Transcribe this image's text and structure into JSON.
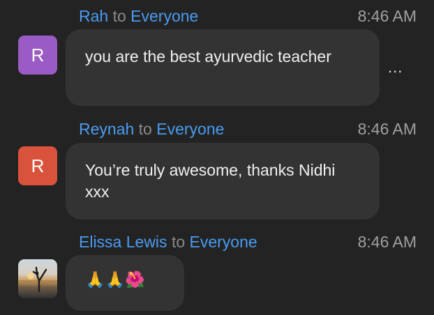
{
  "messages": [
    {
      "sender": "Rah",
      "to_word": "to",
      "recipient": "Everyone",
      "time": "8:46 AM",
      "avatar_initial": "R",
      "avatar_color": "#9b5bc4",
      "text": "you are the best ayurvedic teacher",
      "more_label": "..."
    },
    {
      "sender": "Reynah",
      "to_word": "to",
      "recipient": "Everyone",
      "time": "8:46 AM",
      "avatar_initial": "R",
      "avatar_color": "#d9533c",
      "text": "You’re truly awesome, thanks Nidhi xxx"
    },
    {
      "sender": "Elissa Lewis",
      "to_word": "to",
      "recipient": "Everyone",
      "time": "8:46 AM",
      "avatar_icon": "beach-yoga-photo-icon",
      "text": "🙏🙏🌺"
    }
  ],
  "colors": {
    "background": "#232323",
    "bubble": "#333333",
    "name": "#4a9bf0",
    "muted": "#8a8a8a",
    "time": "#a0a0a0"
  }
}
